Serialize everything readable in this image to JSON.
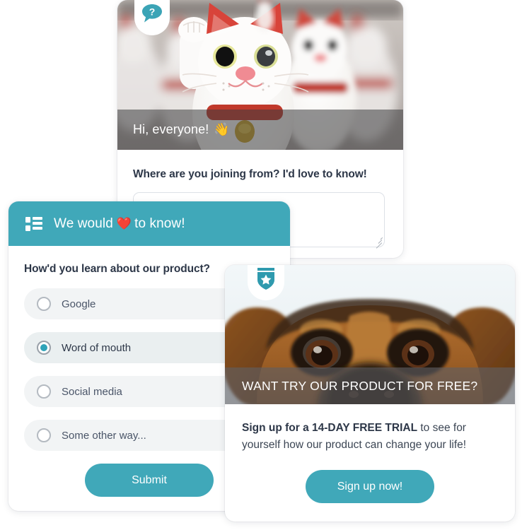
{
  "cards": {
    "welcome": {
      "badge_icon": "question-speech-bubble-icon",
      "hero_caption": "Hi, everyone!",
      "hero_caption_emoji": "👋",
      "hero_image_alt": "maneki-neko lucky cat figurines",
      "question": "Where are you joining from? I'd love to know!",
      "answer_value": "",
      "answer_placeholder": ""
    },
    "poll": {
      "header_icon": "list-icon",
      "header_title_before": "We would",
      "header_emoji": "❤️",
      "header_title_after": "to know!",
      "question": "How'd you learn about our product?",
      "options": [
        {
          "label": "Google",
          "selected": false
        },
        {
          "label": "Word of mouth",
          "selected": true
        },
        {
          "label": "Social media",
          "selected": false
        },
        {
          "label": "Some other way...",
          "selected": false
        }
      ],
      "submit_label": "Submit"
    },
    "promo": {
      "badge_icon": "shield-star-icon",
      "hero_image_alt": "close-up of a dog's eyes peeking over",
      "hero_caption": "WANT TRY OUR PRODUCT FOR FREE?",
      "body_lead": "Sign up for a ",
      "body_highlight": "14-DAY FREE TRIAL",
      "body_rest": " to see for yourself how our product can change your life!",
      "cta_label": "Sign up now!"
    }
  },
  "colors": {
    "accent_teal": "#40a8b9",
    "radio_teal": "#2fa3b8",
    "text_dark": "#2d3748",
    "text_body": "#4a5568",
    "option_bg": "#f2f4f5",
    "caption_overlay": "rgba(60,60,62,0.55)"
  }
}
